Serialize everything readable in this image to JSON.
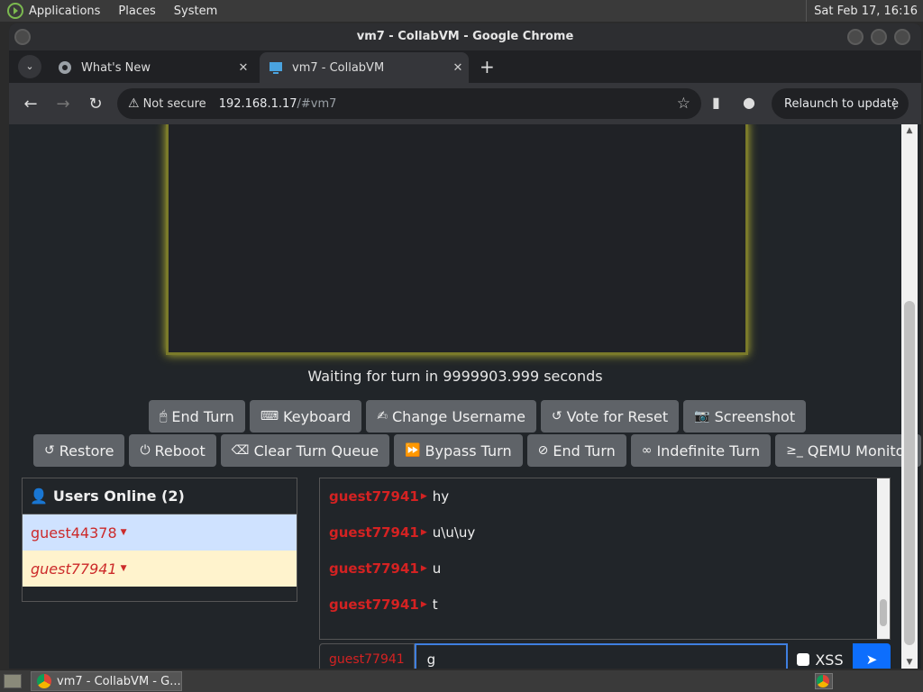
{
  "desktop": {
    "menus": [
      "Applications",
      "Places",
      "System"
    ],
    "clock": "Sat Feb 17, 16:16"
  },
  "window": {
    "title": "vm7 - CollabVM - Google Chrome"
  },
  "tabs": [
    {
      "label": "What's New",
      "active": false
    },
    {
      "label": "vm7 - CollabVM",
      "active": true
    }
  ],
  "address": {
    "security": "Not secure",
    "host": "192.168.1.17",
    "path": "/#vm7",
    "relaunch": "Relaunch to update"
  },
  "vm": {
    "status": "Waiting for turn in 9999903.999 seconds"
  },
  "buttons_row1": [
    {
      "icon": "mouse-icon",
      "glyph": "🖱",
      "label": "End Turn"
    },
    {
      "icon": "keyboard-icon",
      "glyph": "⌨",
      "label": "Keyboard"
    },
    {
      "icon": "signature-icon",
      "glyph": "✍",
      "label": "Change Username"
    },
    {
      "icon": "rotate-left-icon",
      "glyph": "↺",
      "label": "Vote for Reset"
    },
    {
      "icon": "camera-icon",
      "glyph": "📷",
      "label": "Screenshot"
    }
  ],
  "buttons_row2": [
    {
      "icon": "rotate-left-icon",
      "glyph": "↺",
      "label": "Restore"
    },
    {
      "icon": "power-icon",
      "glyph": "⏻",
      "label": "Reboot"
    },
    {
      "icon": "eraser-icon",
      "glyph": "⌫",
      "label": "Clear Turn Queue"
    },
    {
      "icon": "forward-icon",
      "glyph": "⏩",
      "label": "Bypass Turn"
    },
    {
      "icon": "ban-icon",
      "glyph": "⊘",
      "label": "End Turn"
    },
    {
      "icon": "infinity-icon",
      "glyph": "∞",
      "label": "Indefinite Turn"
    },
    {
      "icon": "terminal-icon",
      "glyph": "≥_",
      "label": "QEMU Monitor"
    }
  ],
  "users": {
    "heading": "Users Online (2)",
    "list": [
      "guest44378",
      "guest77941"
    ]
  },
  "chat": {
    "messages": [
      {
        "user": "guest77941",
        "text": "hy"
      },
      {
        "user": "guest77941",
        "text": "u\\u\\uy"
      },
      {
        "user": "guest77941",
        "text": "u"
      },
      {
        "user": "guest77941",
        "text": "t"
      }
    ],
    "username": "guest77941",
    "input_value": "g",
    "xss_label": "XSS"
  },
  "taskbar": {
    "task_label": "vm7 - CollabVM - G..."
  }
}
